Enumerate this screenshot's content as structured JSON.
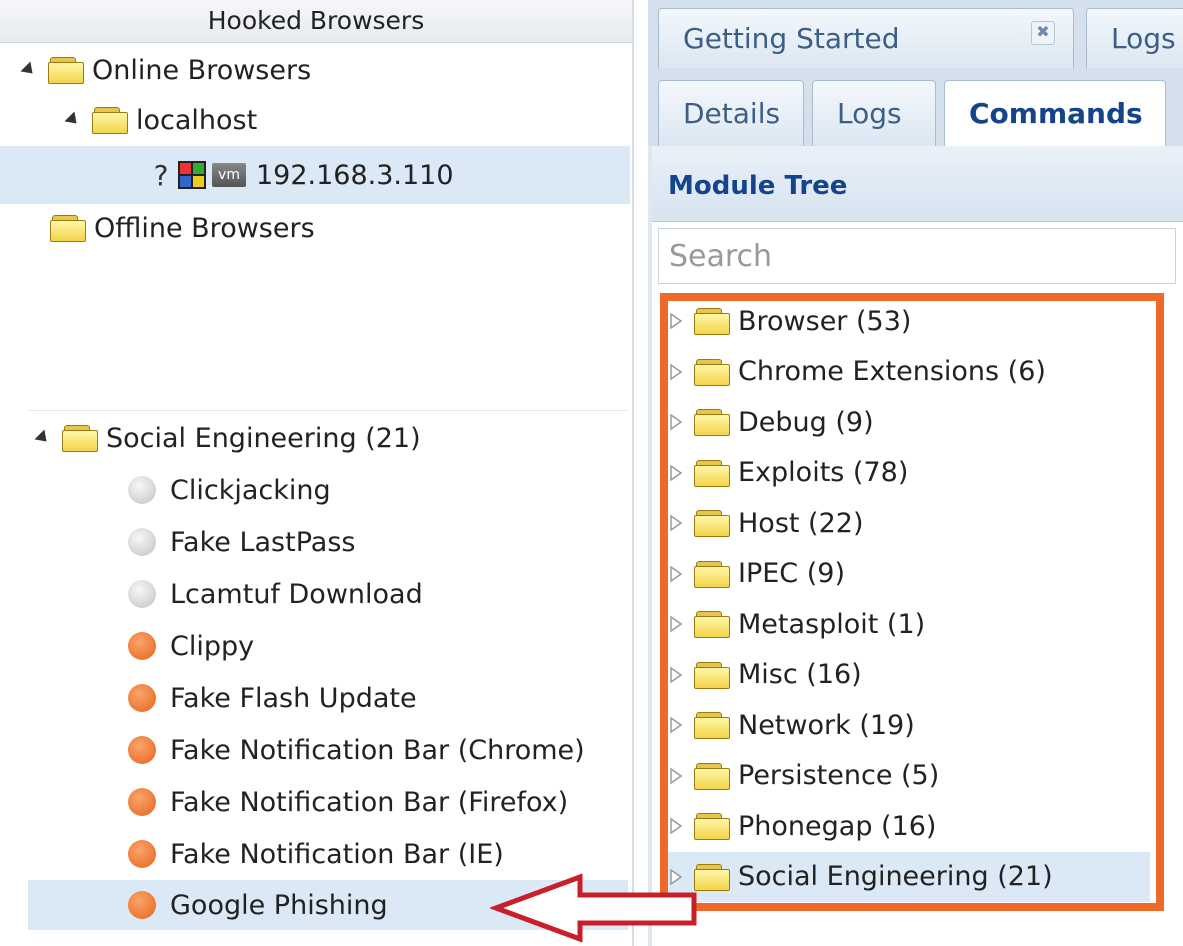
{
  "left_panel": {
    "title": "Hooked Browsers",
    "online": "Online Browsers",
    "host": "localhost",
    "browser_help": "?",
    "vm_label": "vm",
    "ip": "192.168.3.110",
    "offline": "Offline Browsers",
    "category": "Social Engineering (21)",
    "modules": [
      {
        "label": "Clickjacking",
        "status": "grey"
      },
      {
        "label": "Fake LastPass",
        "status": "grey"
      },
      {
        "label": "Lcamtuf Download",
        "status": "grey"
      },
      {
        "label": "Clippy",
        "status": "orange"
      },
      {
        "label": "Fake Flash Update",
        "status": "orange"
      },
      {
        "label": "Fake Notification Bar (Chrome)",
        "status": "orange"
      },
      {
        "label": "Fake Notification Bar (Firefox)",
        "status": "orange"
      },
      {
        "label": "Fake Notification Bar (IE)",
        "status": "orange"
      },
      {
        "label": "Google Phishing",
        "status": "orange"
      }
    ]
  },
  "top_tabs": [
    {
      "label": "Getting Started",
      "close": "✖"
    },
    {
      "label": "Logs"
    }
  ],
  "sub_tabs": [
    {
      "label": "Details"
    },
    {
      "label": "Logs"
    },
    {
      "label": "Commands",
      "active": true
    }
  ],
  "module_tree": {
    "title": "Module Tree",
    "search_placeholder": "Search",
    "items": [
      "Browser (53)",
      "Chrome Extensions (6)",
      "Debug (9)",
      "Exploits (78)",
      "Host (22)",
      "IPEC (9)",
      "Metasploit (1)",
      "Misc (16)",
      "Network (19)",
      "Persistence (5)",
      "Phonegap (16)",
      "Social Engineering (21)"
    ]
  },
  "colors": {
    "highlight_box": "#ef6a28",
    "arrow": "#c8202a",
    "selection": "#dbe8f5",
    "status_orange": "#ee7a36",
    "status_grey": "#cfd2d4"
  }
}
